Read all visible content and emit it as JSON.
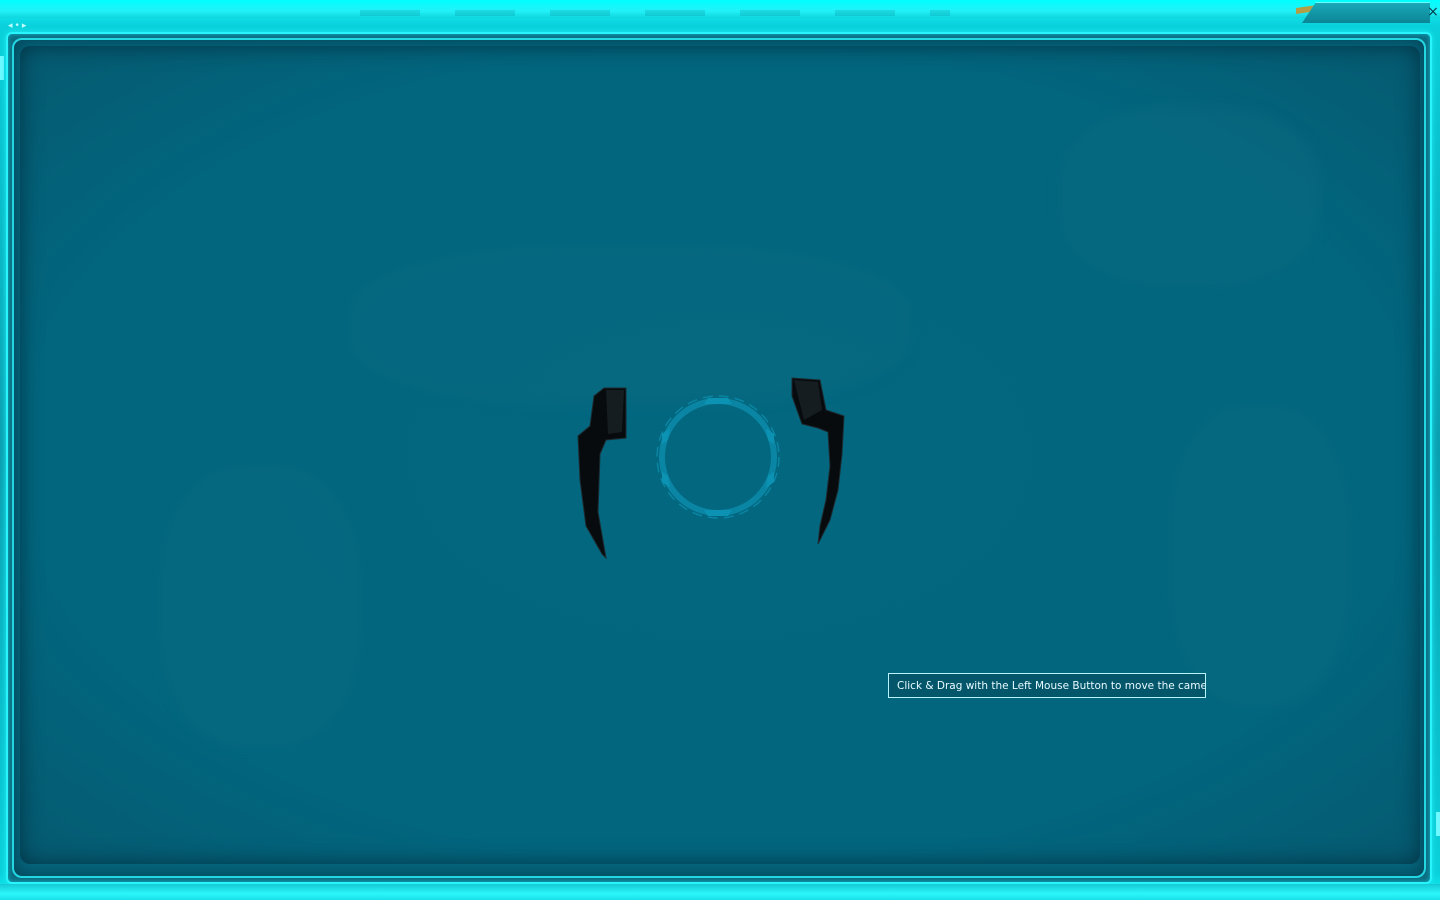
{
  "window": {
    "close_glyph": "×",
    "nav_back_glyph": "◂",
    "nav_dot_glyph": "•",
    "nav_forward_glyph": "▸"
  },
  "viewport": {
    "loading_indicator": "loading-ring-icon",
    "tooltip_text": "Click & Drag with the Left Mouse Button to move the camera."
  },
  "colors": {
    "frame_glow": "#27f4fb",
    "viewport_bg": "#02667e",
    "tooltip_border": "#b7f4ff"
  }
}
